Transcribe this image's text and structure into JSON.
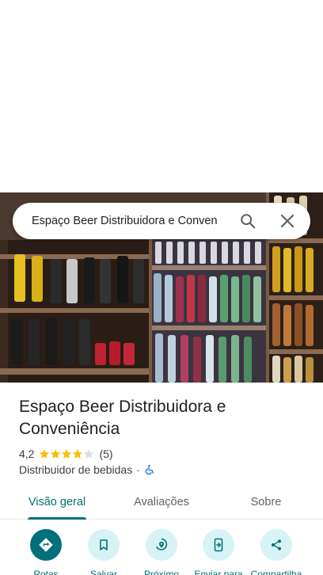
{
  "search": {
    "query": "Espaço Beer Distribuidora e Conven",
    "search_icon": "search-icon",
    "close_icon": "close-icon"
  },
  "hero": {
    "image": "store-shelves-photo"
  },
  "place": {
    "name": "Espaço Beer Distribuidora e Conveniência",
    "rating": "4,2",
    "rating_value": 4.2,
    "rating_max": 5,
    "review_count": "(5)",
    "category": "Distribuidor de bebidas",
    "separator": "·",
    "accessibility_icon": "wheelchair-icon"
  },
  "tabs": [
    {
      "label": "Visão geral",
      "active": true
    },
    {
      "label": "Avaliações",
      "active": false
    },
    {
      "label": "Sobre",
      "active": false
    }
  ],
  "actions": [
    {
      "label": "Rotas",
      "icon": "directions-icon"
    },
    {
      "label": "Salvar",
      "icon": "bookmark-icon"
    },
    {
      "label": "Próximo",
      "icon": "nearby-icon"
    },
    {
      "label": "Enviar para",
      "icon": "send-to-phone-icon"
    },
    {
      "label": "Compartilha",
      "icon": "share-icon"
    }
  ],
  "colors": {
    "accent": "#00707a",
    "accent_light": "#d7f3f5",
    "star": "#fbbc04",
    "star_empty": "#dadce0",
    "accessibility": "#1a73e8"
  }
}
